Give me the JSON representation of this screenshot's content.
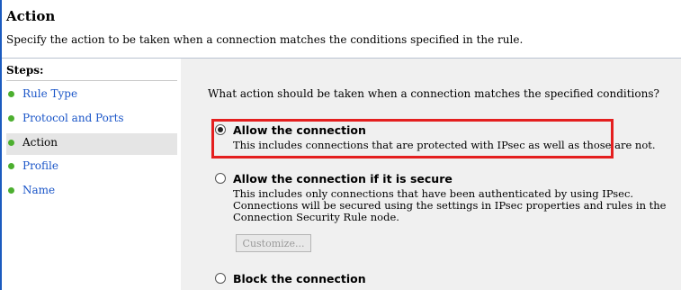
{
  "header": {
    "title": "Action",
    "subtitle": "Specify the action to be taken when a connection matches the conditions specified in the rule."
  },
  "sidebar": {
    "title": "Steps:",
    "items": [
      {
        "label": "Rule Type"
      },
      {
        "label": "Protocol and Ports"
      },
      {
        "label": "Action"
      },
      {
        "label": "Profile"
      },
      {
        "label": "Name"
      }
    ]
  },
  "main": {
    "question": "What action should be taken when a connection matches the specified conditions?",
    "options": [
      {
        "title": "Allow the connection",
        "description": "This includes connections that are protected with IPsec as well as those are not.",
        "selected": true
      },
      {
        "title": "Allow the connection if it is secure",
        "description": "This includes only connections that have been authenticated by using IPsec.  Connections will be secured using the settings in IPsec properties and rules in the Connection Security Rule node.",
        "selected": false
      },
      {
        "title": "Block the connection",
        "description": "",
        "selected": false
      }
    ],
    "customize_label": "Customize..."
  },
  "colors": {
    "highlight": "#e41f1f",
    "step_bullet": "#4caf2f",
    "step_link": "#1a55c8"
  }
}
